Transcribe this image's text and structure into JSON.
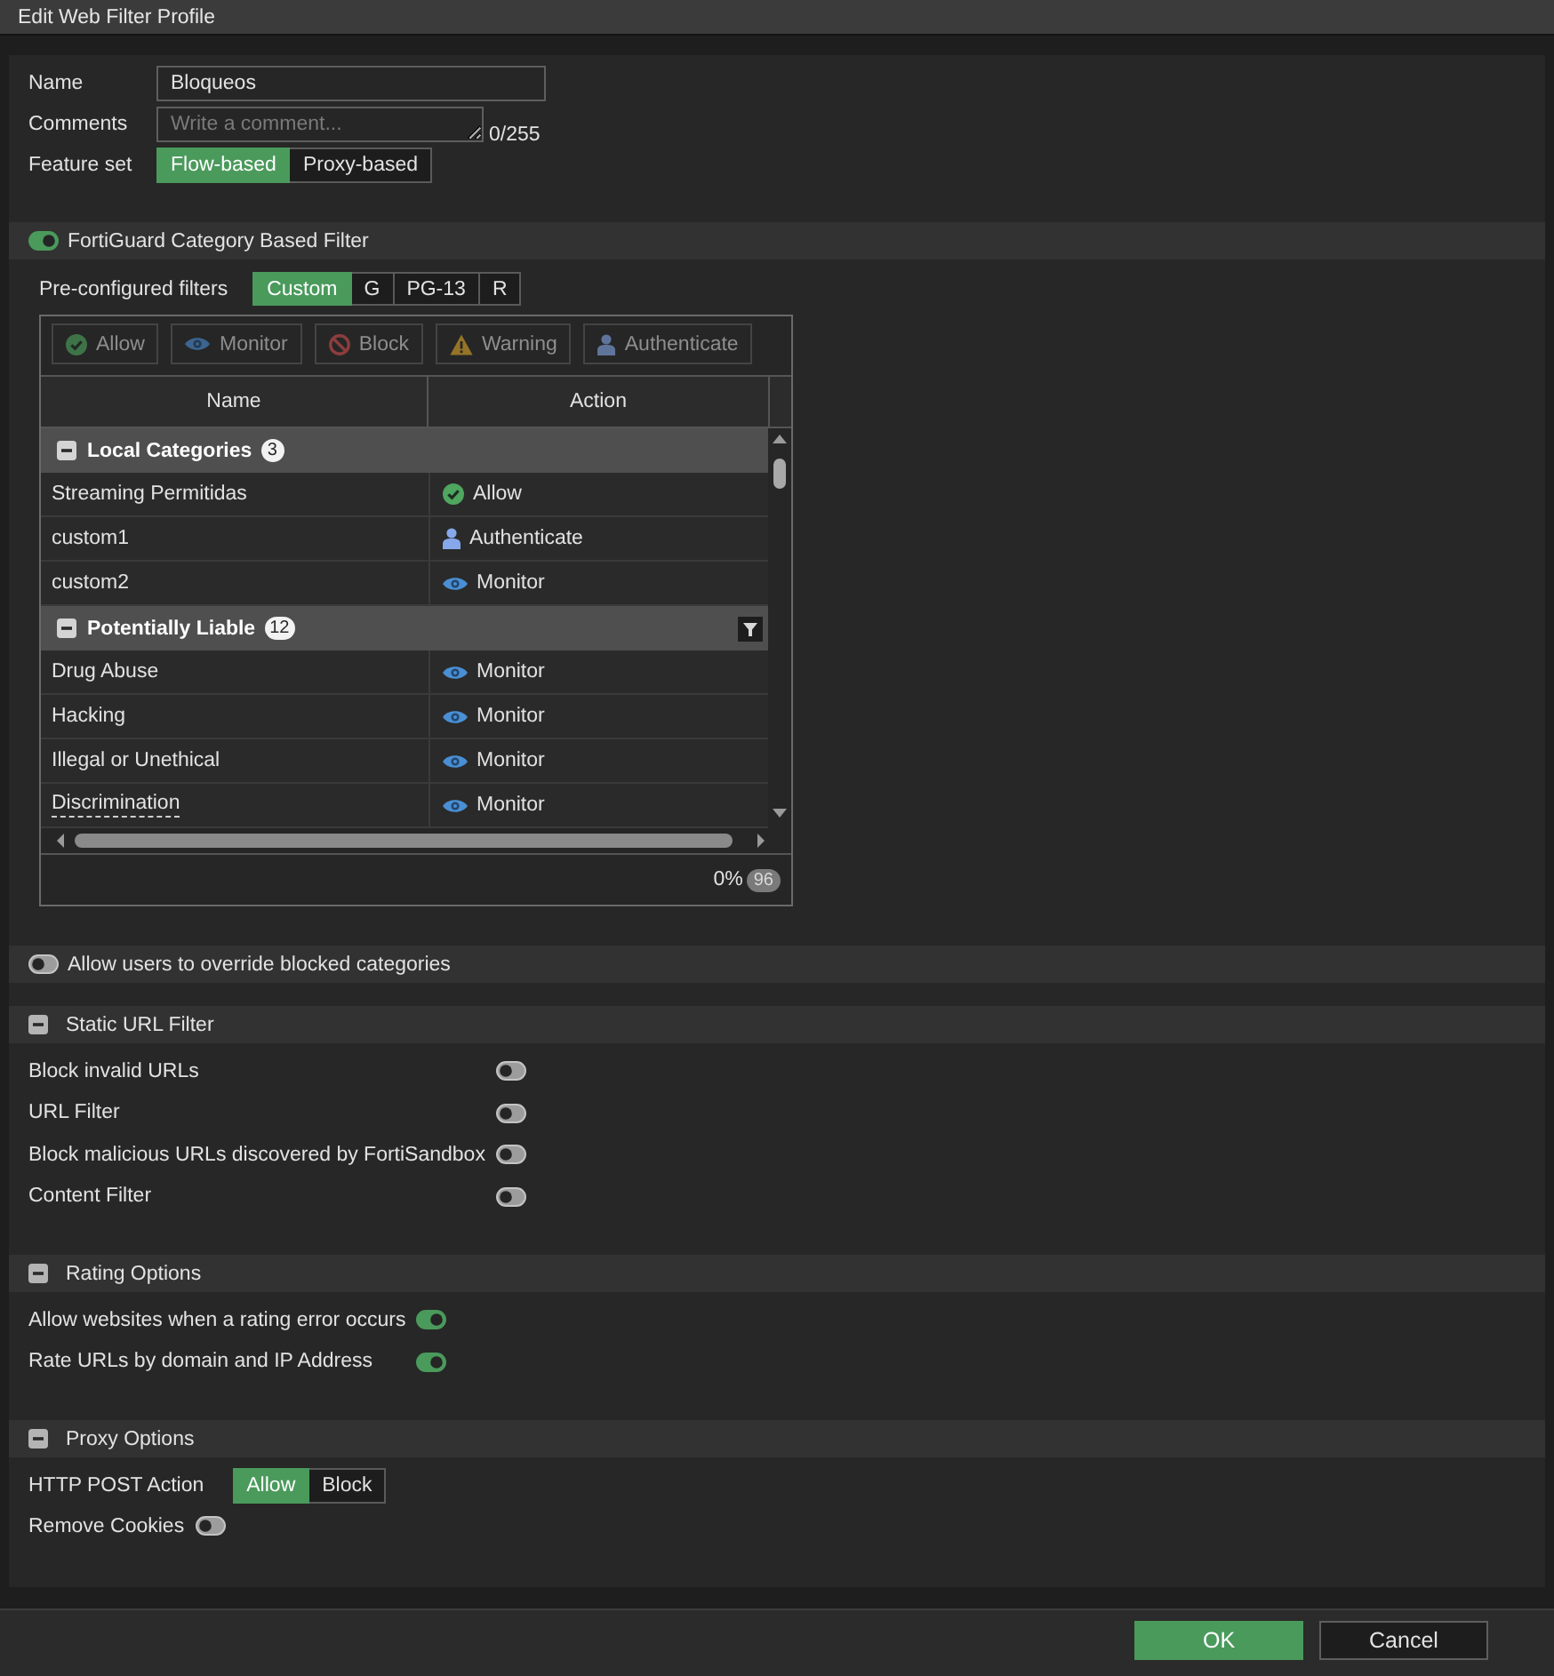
{
  "window": {
    "title": "Edit Web Filter Profile"
  },
  "form": {
    "name": {
      "label": "Name",
      "value": "Bloqueos"
    },
    "comments": {
      "label": "Comments",
      "placeholder": "Write a comment...",
      "counter": "0/255"
    },
    "feature_set": {
      "label": "Feature set",
      "options": [
        {
          "label": "Flow-based",
          "selected": true
        },
        {
          "label": "Proxy-based",
          "selected": false
        }
      ]
    }
  },
  "fortiguard": {
    "label": "FortiGuard Category Based Filter",
    "on": true,
    "preconfigured": {
      "label": "Pre-configured filters",
      "options": [
        {
          "label": "Custom",
          "selected": true
        },
        {
          "label": "G",
          "selected": false
        },
        {
          "label": "PG-13",
          "selected": false
        },
        {
          "label": "R",
          "selected": false
        }
      ]
    },
    "toolbar": [
      {
        "kind": "allow",
        "label": "Allow",
        "disabled": true
      },
      {
        "kind": "monitor",
        "label": "Monitor",
        "disabled": true
      },
      {
        "kind": "block",
        "label": "Block",
        "disabled": true
      },
      {
        "kind": "warning",
        "label": "Warning",
        "disabled": true
      },
      {
        "kind": "authenticate",
        "label": "Authenticate",
        "disabled": true
      }
    ],
    "table": {
      "columns": [
        "Name",
        "Action"
      ],
      "groups": [
        {
          "name": "Local Categories",
          "count": "3",
          "expanded": true,
          "filter_icon": false,
          "rows": [
            {
              "name": "Streaming Permitidas",
              "action": {
                "kind": "allow",
                "label": "Allow"
              },
              "has_tooltip": false
            },
            {
              "name": "custom1",
              "action": {
                "kind": "authenticate",
                "label": "Authenticate"
              },
              "has_tooltip": false
            },
            {
              "name": "custom2",
              "action": {
                "kind": "monitor",
                "label": "Monitor"
              },
              "has_tooltip": false
            }
          ]
        },
        {
          "name": "Potentially Liable",
          "count": "12",
          "expanded": true,
          "filter_icon": true,
          "rows": [
            {
              "name": "Drug Abuse",
              "action": {
                "kind": "monitor",
                "label": "Monitor"
              },
              "has_tooltip": false
            },
            {
              "name": "Hacking",
              "action": {
                "kind": "monitor",
                "label": "Monitor"
              },
              "has_tooltip": false
            },
            {
              "name": "Illegal or Unethical",
              "action": {
                "kind": "monitor",
                "label": "Monitor"
              },
              "has_tooltip": false
            },
            {
              "name": "Discrimination",
              "action": {
                "kind": "monitor",
                "label": "Monitor"
              },
              "has_tooltip": true
            }
          ]
        }
      ],
      "footer": {
        "progress": "0%",
        "count": "96"
      }
    }
  },
  "override": {
    "label": "Allow users to override blocked categories",
    "on": false
  },
  "sections": [
    {
      "title": "Static URL Filter",
      "expanded": true,
      "rows": [
        {
          "kind": "toggle",
          "label": "Block invalid URLs",
          "on": false
        },
        {
          "kind": "toggle",
          "label": "URL Filter",
          "on": false
        },
        {
          "kind": "toggle",
          "label": "Block malicious URLs discovered by FortiSandbox",
          "on": false
        },
        {
          "kind": "toggle",
          "label": "Content Filter",
          "on": false
        }
      ]
    },
    {
      "title": "Rating Options",
      "expanded": true,
      "rows": [
        {
          "kind": "toggle",
          "label": "Allow websites when a rating error occurs",
          "on": true
        },
        {
          "kind": "toggle",
          "label": "Rate URLs by domain and IP Address",
          "on": true
        }
      ]
    },
    {
      "title": "Proxy Options",
      "expanded": true,
      "rows": [
        {
          "kind": "segmented",
          "label": "HTTP POST Action",
          "options": [
            {
              "label": "Allow",
              "selected": true
            },
            {
              "label": "Block",
              "selected": false
            }
          ]
        },
        {
          "kind": "toggle",
          "label": "Remove Cookies",
          "on": false
        }
      ]
    }
  ],
  "buttons": [
    {
      "kind": "primary",
      "label": "OK"
    },
    {
      "kind": "secondary",
      "label": "Cancel"
    }
  ]
}
